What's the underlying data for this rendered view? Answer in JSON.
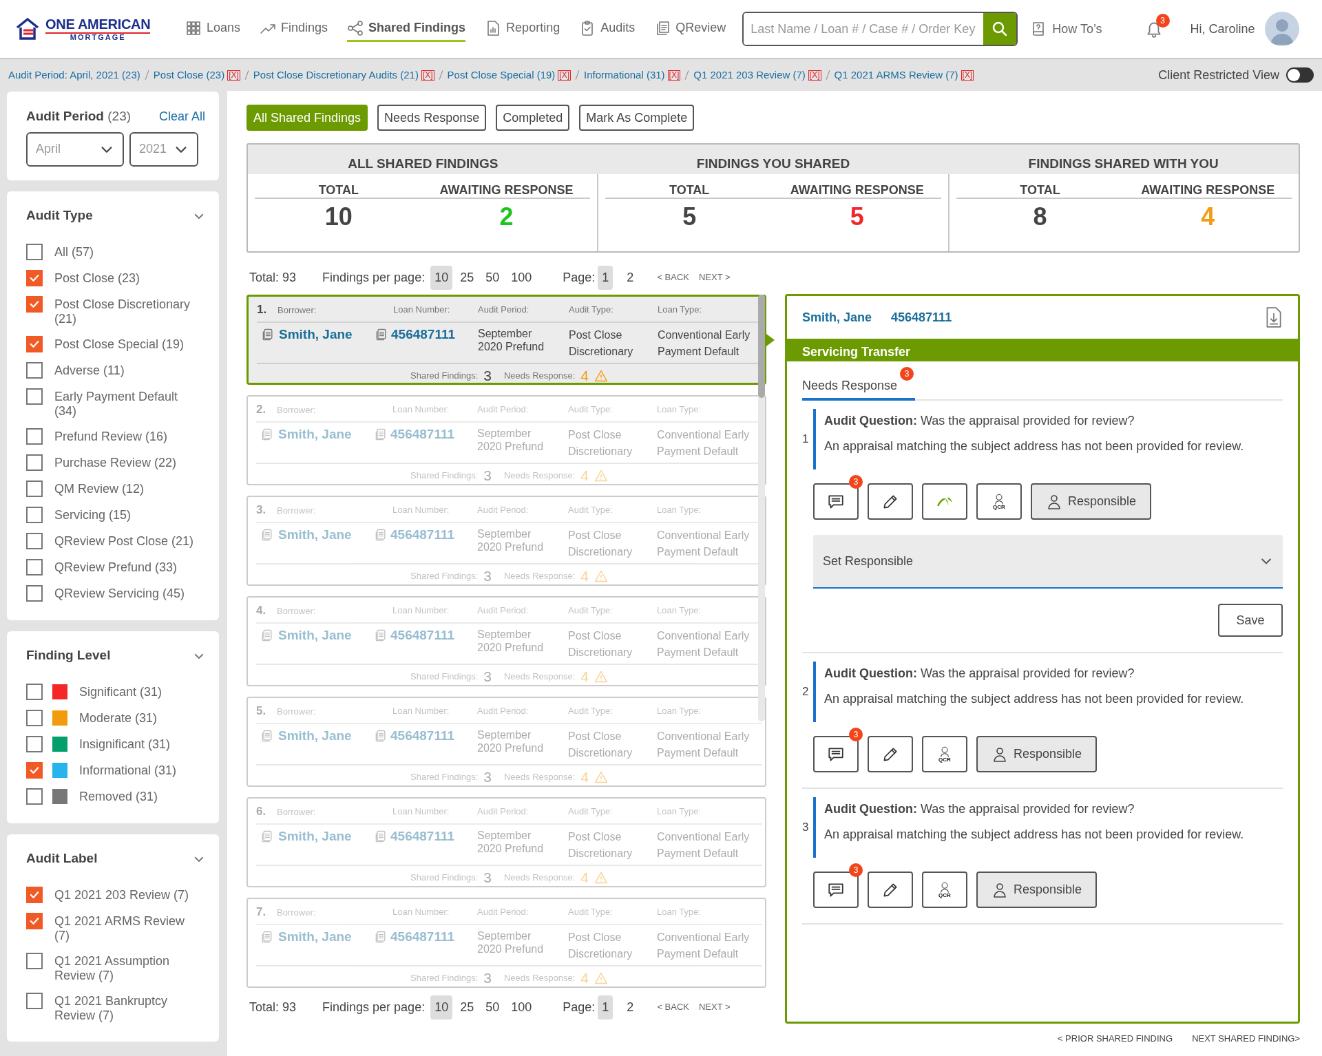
{
  "header": {
    "logo": {
      "line_1": "ONE AMERICAN",
      "line_2": "MORTGAGE"
    },
    "nav": [
      {
        "kind": "loans",
        "label": "Loans",
        "selected": false
      },
      {
        "kind": "findings",
        "label": "Findings",
        "selected": false
      },
      {
        "kind": "shared",
        "label": "Shared Findings",
        "selected": true
      },
      {
        "kind": "reporting",
        "label": "Reporting",
        "selected": false
      },
      {
        "kind": "audits",
        "label": "Audits",
        "selected": false
      },
      {
        "kind": "qreview",
        "label": "QReview",
        "selected": false
      }
    ],
    "search": {
      "placeholder": "Last Name / Loan # / Case # / Order Key"
    },
    "help": "How To’s",
    "notifications": "3",
    "greeting": "Hi, Caroline"
  },
  "breadcrumbs": [
    {
      "label": "Audit Period: April, 2021 (23)"
    },
    {
      "label": "Post Close (23)",
      "remove": "[X]"
    },
    {
      "label": "Post Close Discretionary Audits (21)",
      "remove": "[X]"
    },
    {
      "label": "Post Close Special (19)",
      "remove": "[X]"
    },
    {
      "label": "Informational (31)",
      "remove": "[X]"
    },
    {
      "label": "Q1 2021 203 Review (7)",
      "remove": "[X]"
    },
    {
      "label": "Q1 2021 ARMS Review (7)",
      "remove": "[X]"
    }
  ],
  "client_restricted_view": {
    "label": "Client Restricted View",
    "on": false
  },
  "sidebar": {
    "period": {
      "title": "Audit Period",
      "count": "(23)",
      "clear": "Clear All",
      "month": "April",
      "year": "2021"
    },
    "sections": [
      {
        "title": "Audit Type",
        "items": [
          {
            "label": "All (57)",
            "checked": false
          },
          {
            "label": "Post Close (23)",
            "checked": true
          },
          {
            "label": "Post Close Discretionary (21)",
            "checked": true
          },
          {
            "label": "Post Close Special (19)",
            "checked": true
          },
          {
            "label": "Adverse (11)",
            "checked": false
          },
          {
            "label": "Early Payment Default (34)",
            "checked": false
          },
          {
            "label": "Prefund Review (16)",
            "checked": false
          },
          {
            "label": "Purchase Review (22)",
            "checked": false
          },
          {
            "label": "QM Review (12)",
            "checked": false
          },
          {
            "label": "Servicing (15)",
            "checked": false
          },
          {
            "label": "QReview Post Close (21)",
            "checked": false
          },
          {
            "label": "QReview Prefund (33)",
            "checked": false
          },
          {
            "label": "QReview Servicing (45)",
            "checked": false
          }
        ]
      },
      {
        "title": "Finding Level",
        "items": [
          {
            "label": "Significant (31)",
            "checked": false,
            "color": "#f42626"
          },
          {
            "label": "Moderate (31)",
            "checked": false,
            "color": "#f29b0c"
          },
          {
            "label": "Insignificant (31)",
            "checked": false,
            "color": "#049f6a"
          },
          {
            "label": "Informational (31)",
            "checked": true,
            "color": "#27b3ec"
          },
          {
            "label": "Removed (31)",
            "checked": false,
            "color": "#777777"
          }
        ]
      },
      {
        "title": "Audit Label",
        "items": [
          {
            "label": "Q1 2021 203 Review (7)",
            "checked": true
          },
          {
            "label": "Q1 2021 ARMS Review (7)",
            "checked": true
          },
          {
            "label": "Q1 2021 Assumption Review (7)",
            "checked": false
          },
          {
            "label": "Q1 2021 Bankruptcy Review (7)",
            "checked": false
          }
        ]
      }
    ]
  },
  "tabs": [
    {
      "label": "All Shared Findings",
      "selected": true
    },
    {
      "label": "Needs Response",
      "selected": false
    },
    {
      "label": "Completed",
      "selected": false
    },
    {
      "label": "Mark As Complete",
      "selected": false
    }
  ],
  "stats": [
    {
      "title": "ALL SHARED FINDINGS",
      "metrics": [
        {
          "label": "TOTAL",
          "value": "10"
        },
        {
          "label": "AWAITING RESPONSE",
          "value": "2",
          "color": "#1fc41f"
        }
      ]
    },
    {
      "title": "FINDINGS YOU SHARED",
      "metrics": [
        {
          "label": "TOTAL",
          "value": "5"
        },
        {
          "label": "AWAITING RESPONSE",
          "value": "5",
          "color": "#f0262b"
        }
      ]
    },
    {
      "title": "FINDINGS SHARED WITH YOU",
      "metrics": [
        {
          "label": "TOTAL",
          "value": "8"
        },
        {
          "label": "AWAITING RESPONSE",
          "value": "4",
          "color": "#f39c12"
        }
      ]
    }
  ],
  "pagination_top": {
    "total": "Total: 93",
    "per_page_label": "Findings per page:",
    "per_page": [
      {
        "label": "10",
        "selected": true
      },
      {
        "label": "25",
        "selected": false
      },
      {
        "label": "50",
        "selected": false
      },
      {
        "label": "100",
        "selected": false
      }
    ],
    "page_label": "Page:",
    "pages": [
      {
        "label": "1",
        "selected": true
      },
      {
        "label": "2",
        "selected": false
      }
    ],
    "back": "< BACK",
    "next": "NEXT >"
  },
  "findings": [
    {
      "index": "1.",
      "selected": true,
      "borrower_label": "Borrower:",
      "borrower": "Smith, Jane",
      "loan_label": "Loan Number:",
      "loan": "456487111",
      "period_label": "Audit Period:",
      "period": "September 2020 Prefund",
      "type_label": "Audit Type:",
      "type": "Post Close Discretionary",
      "loan_type_label": "Loan Type:",
      "loan_type": "Conventional Early Payment Default",
      "shared_label": "Shared Findings:",
      "shared": "3",
      "needs_label": "Needs Response:",
      "needs": "4"
    },
    {
      "index": "2.",
      "selected": false,
      "borrower_label": "Borrower:",
      "borrower": "Smith, Jane",
      "loan_label": "Loan Number:",
      "loan": "456487111",
      "period_label": "Audit Period:",
      "period": "September 2020 Prefund",
      "type_label": "Audit Type:",
      "type": "Post Close Discretionary",
      "loan_type_label": "Loan Type:",
      "loan_type": "Conventional Early Payment Default",
      "shared_label": "Shared Findings:",
      "shared": "3",
      "needs_label": "Needs Response:",
      "needs": "4"
    },
    {
      "index": "3.",
      "selected": false,
      "borrower_label": "Borrower:",
      "borrower": "Smith, Jane",
      "loan_label": "Loan Number:",
      "loan": "456487111",
      "period_label": "Audit Period:",
      "period": "September 2020 Prefund",
      "type_label": "Audit Type:",
      "type": "Post Close Discretionary",
      "loan_type_label": "Loan Type:",
      "loan_type": "Conventional Early Payment Default",
      "shared_label": "Shared Findings:",
      "shared": "3",
      "needs_label": "Needs Response:",
      "needs": "4"
    },
    {
      "index": "4.",
      "selected": false,
      "borrower_label": "Borrower:",
      "borrower": "Smith, Jane",
      "loan_label": "Loan Number:",
      "loan": "456487111",
      "period_label": "Audit Period:",
      "period": "September 2020 Prefund",
      "type_label": "Audit Type:",
      "type": "Post Close Discretionary",
      "loan_type_label": "Loan Type:",
      "loan_type": "Conventional Early Payment Default",
      "shared_label": "Shared Findings:",
      "shared": "3",
      "needs_label": "Needs Response:",
      "needs": "4"
    },
    {
      "index": "5.",
      "selected": false,
      "borrower_label": "Borrower:",
      "borrower": "Smith, Jane",
      "loan_label": "Loan Number:",
      "loan": "456487111",
      "period_label": "Audit Period:",
      "period": "September 2020 Prefund",
      "type_label": "Audit Type:",
      "type": "Post Close Discretionary",
      "loan_type_label": "Loan Type:",
      "loan_type": "Conventional Early Payment Default",
      "shared_label": "Shared Findings:",
      "shared": "3",
      "needs_label": "Needs Response:",
      "needs": "4"
    },
    {
      "index": "6.",
      "selected": false,
      "borrower_label": "Borrower:",
      "borrower": "Smith, Jane",
      "loan_label": "Loan Number:",
      "loan": "456487111",
      "period_label": "Audit Period:",
      "period": "September 2020 Prefund",
      "type_label": "Audit Type:",
      "type": "Post Close Discretionary",
      "loan_type_label": "Loan Type:",
      "loan_type": "Conventional Early Payment Default",
      "shared_label": "Shared Findings:",
      "shared": "3",
      "needs_label": "Needs Response:",
      "needs": "4"
    },
    {
      "index": "7.",
      "selected": false,
      "borrower_label": "Borrower:",
      "borrower": "Smith, Jane",
      "loan_label": "Loan Number:",
      "loan": "456487111",
      "period_label": "Audit Period:",
      "period": "September 2020 Prefund",
      "type_label": "Audit Type:",
      "type": "Post Close Discretionary",
      "loan_type_label": "Loan Type:",
      "loan_type": "Conventional Early Payment Default",
      "shared_label": "Shared Findings:",
      "shared": "3",
      "needs_label": "Needs Response:",
      "needs": "4"
    }
  ],
  "pagination_bottom": {
    "total": "Total: 93",
    "per_page_label": "Findings per page:",
    "per_page": [
      {
        "label": "10",
        "selected": true
      },
      {
        "label": "25",
        "selected": false
      },
      {
        "label": "50",
        "selected": false
      },
      {
        "label": "100",
        "selected": false
      }
    ],
    "page_label": "Page:",
    "pages": [
      {
        "label": "1",
        "selected": true
      },
      {
        "label": "2",
        "selected": false
      }
    ],
    "back": "< BACK",
    "next": "NEXT >"
  },
  "detail": {
    "borrower": "Smith, Jane",
    "loan": "456487111",
    "title": "Servicing Transfer",
    "tab": {
      "label": "Needs Response",
      "badge": "3",
      "selected": true
    },
    "questions": [
      {
        "number": "1",
        "question": "**Audit Question:** Was the appraisal provided for review?",
        "description": "An appraisal matching the subject address has not been provided for review.",
        "actions": [
          {
            "kind": "comment",
            "badge": "3"
          },
          {
            "kind": "edit"
          },
          {
            "kind": "logo"
          },
          {
            "kind": "qcr",
            "label": "QCR"
          },
          {
            "kind": "responsible",
            "label": "Responsible"
          }
        ],
        "expanded": true,
        "dropdown": "Set Responsible",
        "save": "Save"
      },
      {
        "number": "2",
        "question": "**Audit Question:** Was the appraisal provided for review?",
        "description": "An appraisal matching the subject address has not been provided for review.",
        "actions": [
          {
            "kind": "comment",
            "badge": "3"
          },
          {
            "kind": "edit"
          },
          {
            "kind": "qcr",
            "label": "QCR"
          },
          {
            "kind": "responsible",
            "label": "Responsible"
          }
        ],
        "expanded": false
      },
      {
        "number": "3",
        "question": "**Audit Question:** Was the appraisal provided for review?",
        "description": "An appraisal matching the subject address has not been provided for review.",
        "actions": [
          {
            "kind": "comment",
            "badge": "3"
          },
          {
            "kind": "edit"
          },
          {
            "kind": "qcr",
            "label": "QCR"
          },
          {
            "kind": "responsible",
            "label": "Responsible"
          }
        ],
        "expanded": false
      }
    ]
  },
  "footer": {
    "prior": "< PRIOR SHARED FINDING",
    "next": "NEXT SHARED FINDING>"
  }
}
